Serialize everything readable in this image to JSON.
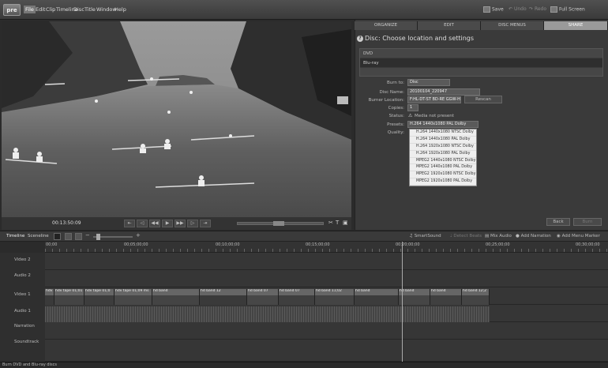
{
  "app": {
    "logo": "pre"
  },
  "menu": [
    "File",
    "Edit",
    "Clip",
    "Timeline",
    "Disc",
    "Title",
    "Window",
    "Help"
  ],
  "toolbar": {
    "save": "Save",
    "undo": "Undo",
    "redo": "Redo",
    "fullscreen": "Full Screen"
  },
  "tabs": [
    "ORGANIZE",
    "EDIT",
    "DISC MENUS",
    "SHARE"
  ],
  "active_tab": "SHARE",
  "panel": {
    "title": "Disc: Choose location and settings",
    "destinations": [
      "DVD",
      "Blu-ray"
    ],
    "fields": {
      "burn_to_label": "Burn to:",
      "burn_to_value": "Disc",
      "disc_name_label": "Disc Name:",
      "disc_name_value": "20100104_220947",
      "burner_label": "Burner Location:",
      "burner_value": "F:HL-DT-ST BD-RE GGW-H...",
      "rescan": "Rescan",
      "copies_label": "Copies:",
      "copies_value": "1",
      "status_label": "Status:",
      "status_value": "Media not present",
      "presets_label": "Presets:",
      "presets_value": "H.264 1440x1080 PAL Dolby",
      "quality_label": "Quality:"
    },
    "preset_options": [
      "H.264 1440x1080 NTSC Dolby",
      "H.264 1440x1080 PAL Dolby",
      "H.264 1920x1080 NTSC Dolby",
      "H.264 1920x1080 PAL Dolby",
      "MPEG2 1440x1080 NTSC Dolby",
      "MPEG2 1440x1080 PAL Dolby",
      "MPEG2 1920x1080 NTSC Dolby",
      "MPEG2 1920x1080 PAL Dolby"
    ],
    "back": "Back",
    "burn": "Burn"
  },
  "monitor": {
    "timecode": "00:13:50:09"
  },
  "timeline": {
    "tabs": [
      "Timeline",
      "Sceneline"
    ],
    "tools": [
      "SmartSound",
      "Detect Beats",
      "Mix Audio",
      "Add Narration",
      "Add Menu Marker"
    ],
    "ruler": [
      "00;00",
      "00;05;00;00",
      "00;10;00;00",
      "00;15;00;00",
      "00;20;00;00",
      "00;25;00;00",
      "00;30;00;00"
    ],
    "tracks": [
      "Video 2",
      "Audio 2",
      "Video 1",
      "Audio 1",
      "Narration",
      "Soundtrack"
    ],
    "clips": [
      "hdv",
      "hdv tape 01;01",
      "hdv tape 01;0",
      "hdv tape 01;09 ms",
      "hd band",
      "hd band 12",
      "hd band 07",
      "hd band 07",
      "hd band 11;02",
      "hd band",
      "hd band",
      "hd band",
      "hd band 12;2"
    ]
  },
  "status": "Burn DVD and Blu-ray discs"
}
